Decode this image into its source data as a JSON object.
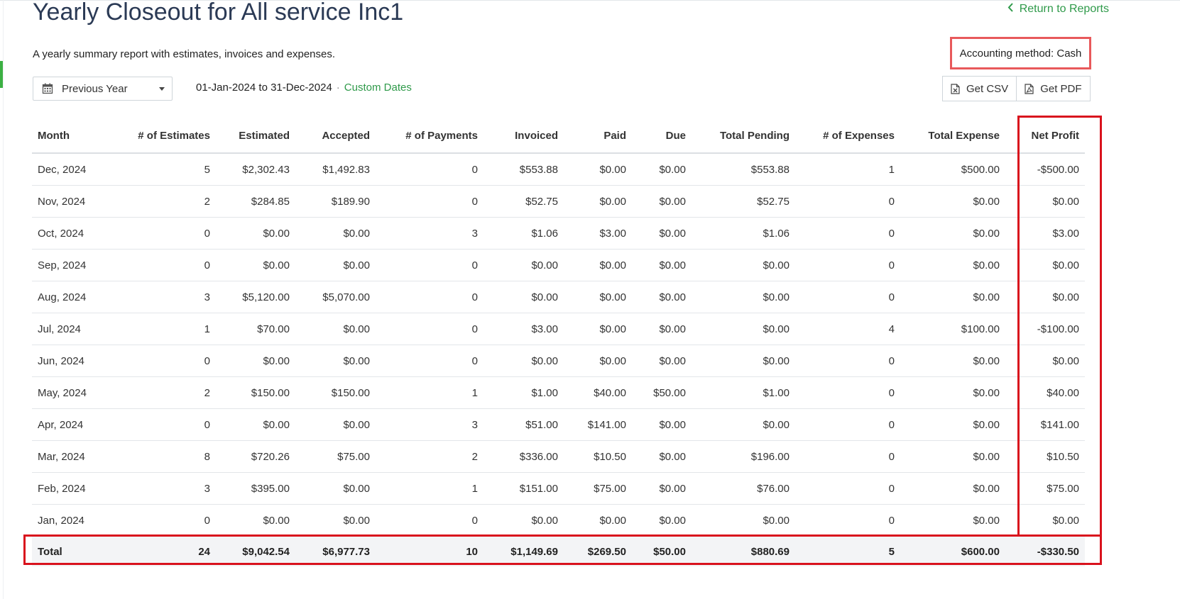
{
  "header": {
    "title": "Yearly Closeout for All service Inc1",
    "return_label": "Return to Reports",
    "subtitle": "A yearly summary report with estimates, invoices and expenses.",
    "accounting_method": "Accounting method: Cash"
  },
  "filters": {
    "period_selected": "Previous Year",
    "date_range": "01-Jan-2024 to 31-Dec-2024",
    "separator": "·",
    "custom_dates_label": "Custom Dates"
  },
  "actions": {
    "csv_label": "Get CSV",
    "pdf_label": "Get PDF"
  },
  "table": {
    "columns": [
      "Month",
      "# of Estimates",
      "Estimated",
      "Accepted",
      "# of Payments",
      "Invoiced",
      "Paid",
      "Due",
      "Total Pending",
      "# of Expenses",
      "Total Expense",
      "Net Profit"
    ],
    "rows": [
      [
        "Dec, 2024",
        "5",
        "$2,302.43",
        "$1,492.83",
        "0",
        "$553.88",
        "$0.00",
        "$0.00",
        "$553.88",
        "1",
        "$500.00",
        "-$500.00"
      ],
      [
        "Nov, 2024",
        "2",
        "$284.85",
        "$189.90",
        "0",
        "$52.75",
        "$0.00",
        "$0.00",
        "$52.75",
        "0",
        "$0.00",
        "$0.00"
      ],
      [
        "Oct, 2024",
        "0",
        "$0.00",
        "$0.00",
        "3",
        "$1.06",
        "$3.00",
        "$0.00",
        "$1.06",
        "0",
        "$0.00",
        "$3.00"
      ],
      [
        "Sep, 2024",
        "0",
        "$0.00",
        "$0.00",
        "0",
        "$0.00",
        "$0.00",
        "$0.00",
        "$0.00",
        "0",
        "$0.00",
        "$0.00"
      ],
      [
        "Aug, 2024",
        "3",
        "$5,120.00",
        "$5,070.00",
        "0",
        "$0.00",
        "$0.00",
        "$0.00",
        "$0.00",
        "0",
        "$0.00",
        "$0.00"
      ],
      [
        "Jul, 2024",
        "1",
        "$70.00",
        "$0.00",
        "0",
        "$3.00",
        "$0.00",
        "$0.00",
        "$0.00",
        "4",
        "$100.00",
        "-$100.00"
      ],
      [
        "Jun, 2024",
        "0",
        "$0.00",
        "$0.00",
        "0",
        "$0.00",
        "$0.00",
        "$0.00",
        "$0.00",
        "0",
        "$0.00",
        "$0.00"
      ],
      [
        "May, 2024",
        "2",
        "$150.00",
        "$150.00",
        "1",
        "$1.00",
        "$40.00",
        "$50.00",
        "$1.00",
        "0",
        "$0.00",
        "$40.00"
      ],
      [
        "Apr, 2024",
        "0",
        "$0.00",
        "$0.00",
        "3",
        "$51.00",
        "$141.00",
        "$0.00",
        "$0.00",
        "0",
        "$0.00",
        "$141.00"
      ],
      [
        "Mar, 2024",
        "8",
        "$720.26",
        "$75.00",
        "2",
        "$336.00",
        "$10.50",
        "$0.00",
        "$196.00",
        "0",
        "$0.00",
        "$10.50"
      ],
      [
        "Feb, 2024",
        "3",
        "$395.00",
        "$0.00",
        "1",
        "$151.00",
        "$75.00",
        "$0.00",
        "$76.00",
        "0",
        "$0.00",
        "$75.00"
      ],
      [
        "Jan, 2024",
        "0",
        "$0.00",
        "$0.00",
        "0",
        "$0.00",
        "$0.00",
        "$0.00",
        "$0.00",
        "0",
        "$0.00",
        "$0.00"
      ]
    ],
    "total": [
      "Total",
      "24",
      "$9,042.54",
      "$6,977.73",
      "10",
      "$1,149.69",
      "$269.50",
      "$50.00",
      "$880.69",
      "5",
      "$600.00",
      "-$330.50"
    ]
  },
  "colors": {
    "title": "#2b3a55",
    "link": "#2f9a4a",
    "highlight_box": "#d9121d",
    "accounting_box": "#e8595b"
  },
  "icons": [
    "chevron-left-icon",
    "calendar-icon",
    "caret-down-icon",
    "csv-file-icon",
    "pdf-file-icon"
  ]
}
